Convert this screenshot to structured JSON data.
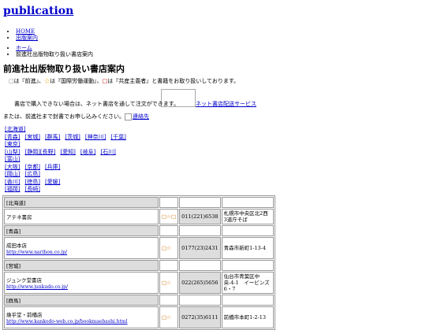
{
  "site": {
    "title": "publication"
  },
  "nav": {
    "items": [
      "HOME",
      "出版案内"
    ]
  },
  "breadcrumb": {
    "items": [
      "ホーム",
      "前進社出版物取り扱い書店案内"
    ]
  },
  "page": {
    "title": "前進社出版物取り扱い書店案内",
    "legend": {
      "sym_a": "□",
      "part1": "は『前進』、",
      "sym_b": "☆",
      "part2": "は『国際労働運動』、",
      "sym_c": "□",
      "part3": "は『共産主義者』と書籍をお取り扱いしております。"
    },
    "notice": "書店で購入できない場合は、ネット書店を通して注文ができます。",
    "net_service_link": "ネット書店配送サービス",
    "mail_text": "または、前進社まで封書でお申し込みください。",
    "contact_link": "連絡先"
  },
  "regions": [
    [
      "[北海道]"
    ],
    [
      "[青森]",
      "[宮城]",
      "[群馬]",
      "[茨城]",
      "[神奈川]",
      "[千葉]"
    ],
    [
      "[東京]"
    ],
    [
      "[山梨]",
      "[静岡][長野]",
      "[愛知]",
      "[岐阜]",
      "[石川]"
    ],
    [
      "[富山]"
    ],
    [
      "[大阪]",
      "[京都]",
      "[兵庫]"
    ],
    [
      "[岡山]",
      "[広島]"
    ],
    [
      "[香川]",
      "[徳島]",
      "[愛媛]"
    ],
    [
      "[福岡]",
      "[長崎]"
    ]
  ],
  "stores": [
    {
      "region": "[北海道]",
      "name": "アテネ書房",
      "url": "",
      "marks": "□☆□",
      "phone": "011(221)6538",
      "address": "札幌市中央区北2西3道庁そば"
    },
    {
      "region": "[青森]",
      "name": "成田本店",
      "url": "http://www.narihon.co.jp/",
      "marks": "□☆",
      "phone": "0177(23)2431",
      "address": "青森市新町1-13-4"
    },
    {
      "region": "[宮城]",
      "name": "ジュンク堂書店",
      "url": "http://www.junkudo.co.jp/",
      "marks": "□☆",
      "phone": "022(265)5656",
      "address": "仙台市青葉区中央-4-1　イービンズ6・7"
    },
    {
      "region": "[群馬]",
      "name": "煥乎堂・前橋店",
      "url": "http://www.kankodo-web.co.jp/bookmaebashi.html",
      "marks": "□☆",
      "phone": "0272(35)6111",
      "address": "前橋市本町1-2-13"
    }
  ]
}
